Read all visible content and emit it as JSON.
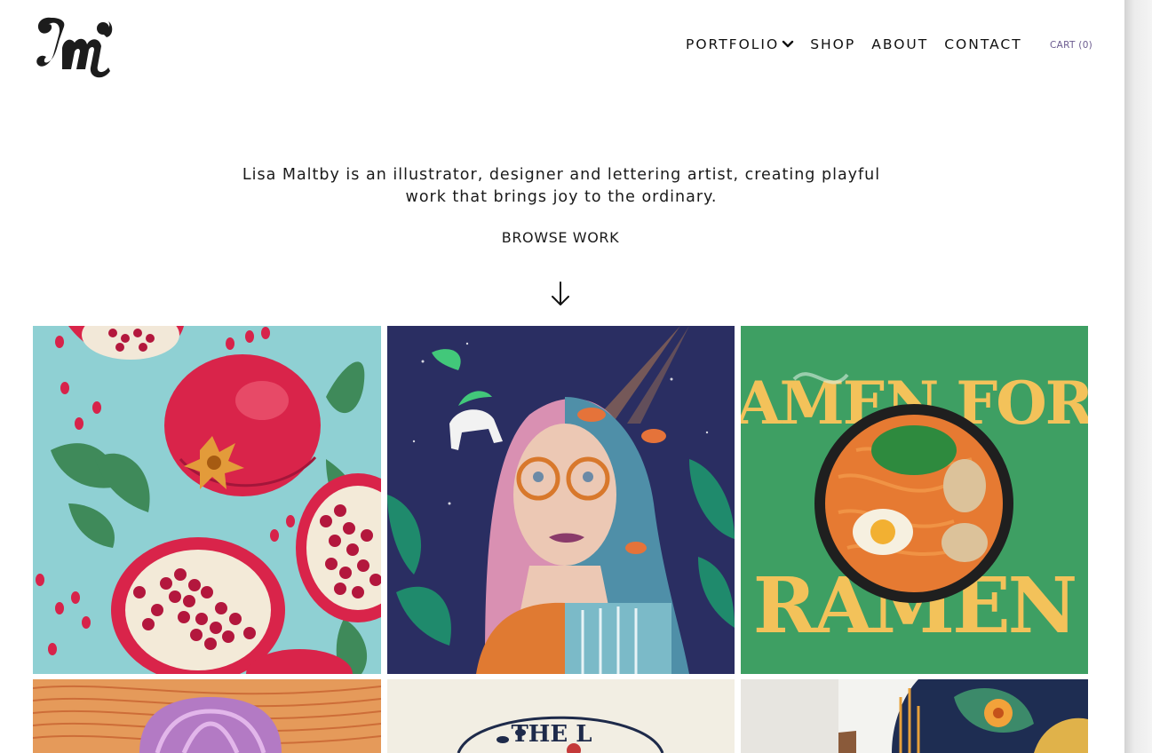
{
  "site": {
    "logo_text": "lm"
  },
  "nav": {
    "items": [
      {
        "label": "PORTFOLIO"
      },
      {
        "label": "SHOP"
      },
      {
        "label": "ABOUT"
      },
      {
        "label": "CONTACT"
      }
    ],
    "cart_label": "CART (0)"
  },
  "intro": {
    "text": "Lisa Maltby is an illustrator, designer and lettering artist, creating playful work that brings joy to the ordinary.",
    "browse_label": "BROWSE WORK"
  },
  "grid": {
    "tile3_text_top": "AMEN FOR",
    "tile3_text_bottom": "RAMEN",
    "tile5_text": "THE L"
  },
  "colors": {
    "accent": "#6b5b8f",
    "tile_pomegranate_bg": "#8fcfd2",
    "tile_portrait_bg": "#2a2f63",
    "tile_ramen_bg": "#3d9f63",
    "tile_ramen_text": "#f3c25a"
  }
}
